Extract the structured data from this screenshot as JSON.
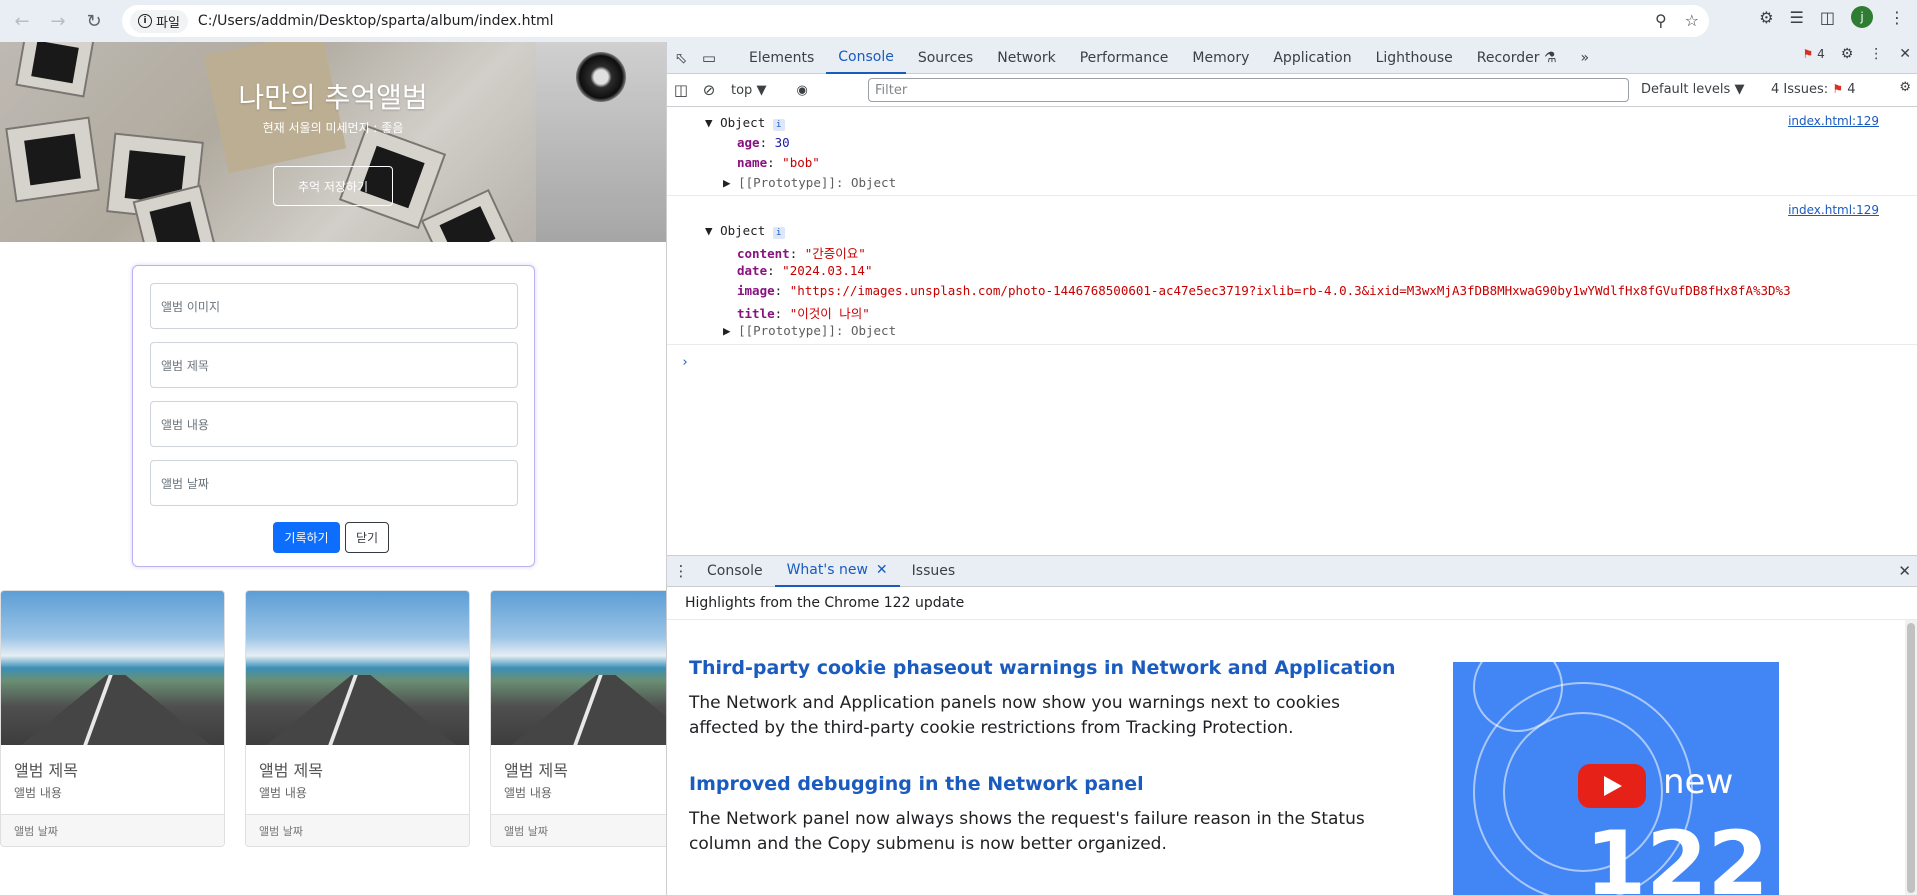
{
  "browser": {
    "site_chip": "파일",
    "url": "C:/Users/addmin/Desktop/sparta/album/index.html",
    "avatar": "j"
  },
  "page": {
    "hero": {
      "title": "나만의 추억앨범",
      "subtitle": "현재 서울의 미세먼지 : 좋음",
      "button": "추억 저장하기"
    },
    "form": {
      "image_placeholder": "앨범 이미지",
      "title_placeholder": "앨범 제목",
      "content_placeholder": "앨범 내용",
      "date_placeholder": "앨범 날짜",
      "submit": "기록하기",
      "close": "닫기"
    },
    "cards": [
      {
        "title": "앨범 제목",
        "text": "앨범 내용",
        "footer": "앨범 날짜"
      },
      {
        "title": "앨범 제목",
        "text": "앨범 내용",
        "footer": "앨범 날짜"
      },
      {
        "title": "앨범 제목",
        "text": "앨범 내용",
        "footer": "앨범 날짜"
      }
    ]
  },
  "devtools": {
    "tabs": [
      "Elements",
      "Console",
      "Sources",
      "Network",
      "Performance",
      "Memory",
      "Application",
      "Lighthouse",
      "Recorder"
    ],
    "active_tab": "Console",
    "error_count": "4",
    "context": "top",
    "filter_placeholder": "Filter",
    "levels": "Default levels",
    "issues_label": "4 Issues:",
    "issues_count": "4",
    "logs": [
      {
        "source": "index.html:129",
        "label": "Object",
        "props": [
          {
            "key": "age",
            "value": "30",
            "type": "num"
          },
          {
            "key": "name",
            "value": "\"bob\"",
            "type": "str"
          }
        ],
        "prototype": "[[Prototype]]: Object"
      },
      {
        "source": "index.html:129",
        "label": "Object",
        "props": [
          {
            "key": "content",
            "value": "\"간증이요\"",
            "type": "str"
          },
          {
            "key": "date",
            "value": "\"2024.03.14\"",
            "type": "str"
          },
          {
            "key": "image",
            "value": "\"https://images.unsplash.com/photo-1446768500601-ac47e5ec3719?ixlib=rb-4.0.3&ixid=M3wxMjA3fDB8MHxwaG90by1wYWdlfHx8fGVufDB8fHx8fA%3D%3",
            "type": "str"
          },
          {
            "key": "title",
            "value": "\"이것이 나의\"",
            "type": "str"
          }
        ],
        "prototype": "[[Prototype]]: Object"
      }
    ],
    "drawer_tabs": [
      "Console",
      "What's new",
      "Issues"
    ],
    "drawer_active": "What's new",
    "whats_new": {
      "header": "Highlights from the Chrome 122 update",
      "h1": "Third-party cookie phaseout warnings in Network and Application",
      "p1": "The Network and Application panels now show you warnings next to cookies affected by the third-party cookie restrictions from Tracking Protection.",
      "h2": "Improved debugging in the Network panel",
      "p2": "The Network panel now always shows the request's failure reason in the Status column and the Copy submenu is now better organized.",
      "banner_new": "new",
      "banner_version": "122"
    }
  }
}
